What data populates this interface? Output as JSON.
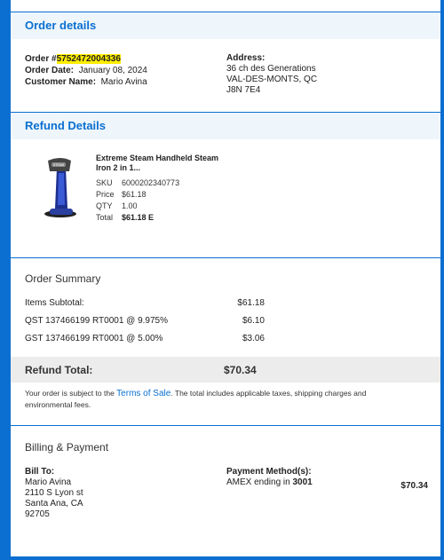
{
  "order": {
    "section_title": "Order details",
    "order_label": "Order #",
    "order_number": "5752472004336",
    "date_label": "Order Date:",
    "date": "January 08, 2024",
    "customer_label": "Customer Name:",
    "customer": "Mario Avina",
    "address_label": "Address:",
    "address": [
      "36 ch des Generations",
      "VAL-DES-MONTS, QC",
      "J8N 7E4"
    ]
  },
  "refund": {
    "section_title": "Refund Details",
    "product": {
      "title": "Extreme Steam Handheld Steam Iron 2 in 1...",
      "sku_label": "SKU",
      "sku": "6000202340773",
      "price_label": "Price",
      "price": "$61.18",
      "qty_label": "QTY",
      "qty": "1.00",
      "total_label": "Total",
      "total": "$61.18 E"
    }
  },
  "summary": {
    "title": "Order Summary",
    "rows": [
      {
        "label": "Items Subtotal:",
        "value": "$61.18"
      },
      {
        "label": "QST 137466199 RT0001 @ 9.975%",
        "value": "$6.10"
      },
      {
        "label": "GST 137466199 RT0001 @ 5.00%",
        "value": "$3.06"
      }
    ],
    "refund_total_label": "Refund Total:",
    "refund_total": "$70.34",
    "terms_pre": "Your order is subject to the ",
    "terms_link": "Terms of Sale",
    "terms_post": ". The total includes applicable taxes, shipping charges and environmental fees."
  },
  "billing": {
    "title": "Billing & Payment",
    "bill_to_label": "Bill To:",
    "bill_to": [
      "Mario Avina",
      "2110 S Lyon st",
      "Santa Ana, CA",
      "92705"
    ],
    "payment_label": "Payment Method(s):",
    "payment_method": "AMEX ending in ",
    "card_last4": "3001",
    "payment_amount": "$70.34"
  },
  "colors": {
    "accent": "#0a6fd1",
    "highlight": "#ffee00"
  }
}
